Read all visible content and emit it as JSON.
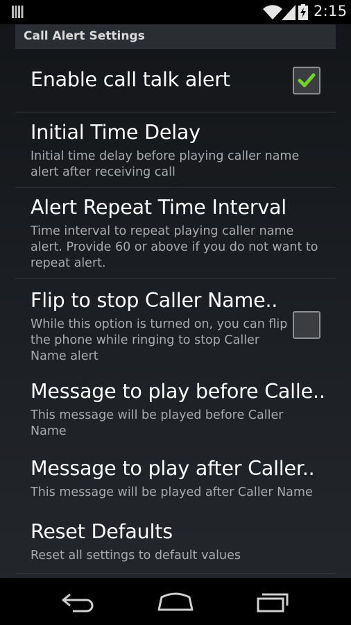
{
  "status_bar": {
    "time": "2:15",
    "icons": [
      "notification-icon",
      "wifi-icon",
      "signal-icon",
      "battery-icon"
    ]
  },
  "category": {
    "label": "Call Alert Settings"
  },
  "preferences": [
    {
      "title": "Enable call talk alert",
      "summary": "",
      "has_checkbox": true,
      "checked": true
    },
    {
      "title": "Initial Time Delay",
      "summary_lines": [
        "Initial time delay before playing caller name",
        "alert after receiving call"
      ],
      "has_checkbox": false
    },
    {
      "title": "Alert Repeat Time Interval",
      "summary_lines": [
        "Time interval to repeat playing caller name",
        "alert. Provide 60 or above if you do not want to",
        "repeat alert."
      ],
      "has_checkbox": false
    },
    {
      "title": "Flip to stop Caller Name..",
      "summary_lines": [
        "While this option is turned on, you can flip",
        "the phone while ringing to stop Caller",
        "Name alert"
      ],
      "has_checkbox": true,
      "checked": false
    },
    {
      "title": "Message to play before Calle..",
      "summary_lines": [
        "This message will be played before Caller",
        "Name"
      ],
      "has_checkbox": false
    },
    {
      "title": "Message to play after Caller..",
      "summary_lines": [
        "This message will be played after Caller Name"
      ],
      "has_checkbox": false
    },
    {
      "title": "Reset Defaults",
      "summary_lines": [
        "Reset all settings to default values"
      ],
      "has_checkbox": false
    }
  ],
  "nav_bar": {
    "buttons": [
      "back-icon",
      "home-icon",
      "recents-icon"
    ]
  },
  "colors": {
    "check_mark": "#6fd32a",
    "title_text": "#ffffff",
    "summary_text": "#a8aaad"
  }
}
